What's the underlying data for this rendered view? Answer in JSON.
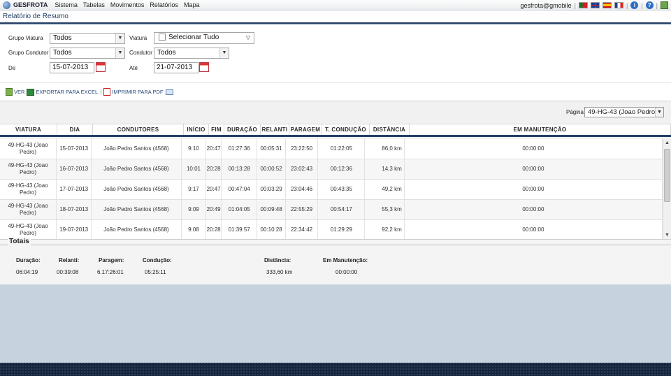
{
  "app": {
    "brand": "GESFROTA",
    "menu": [
      "Sistema",
      "Tabelas",
      "Movimentos",
      "Relatórios",
      "Mapa"
    ],
    "user": "gesfrota@gmobile",
    "separator": "|"
  },
  "page_title": "Relatório de Resumo",
  "filters": {
    "grupo_viatura_label": "Grupo Viatura",
    "grupo_viatura_value": "Todos",
    "viatura_label": "Viatura",
    "viatura_value": "Selecionar Tudo",
    "grupo_condutor_label": "Grupo Condutor",
    "grupo_condutor_value": "Todos",
    "condutor_label": "Condutor",
    "condutor_value": "Todos",
    "de_label": "De",
    "de_value": "15-07-2013",
    "ate_label": "Até",
    "ate_value": "21-07-2013"
  },
  "actions": {
    "ver": "VER",
    "excel": "EXPORTAR PARA EXCEL",
    "pdf": "IMPRIMIR PARA PDF",
    "sep": "|"
  },
  "pager": {
    "label": "Página",
    "value": "49-HG-43 (Joao Pedro)"
  },
  "table": {
    "headers": [
      "VIATURA",
      "DIA",
      "CONDUTORES",
      "INÍCIO",
      "FIM",
      "DURAÇÃO",
      "RELANTI",
      "PARAGEM",
      "T. CONDUÇÃO",
      "DISTÂNCIA",
      "EM MANUTENÇÃO"
    ],
    "rows": [
      [
        "49-HG-43 (Joao Pedro)",
        "15-07-2013",
        "João Pedro Santos (4568)",
        "9:10",
        "20:47",
        "01:27:36",
        "00:05:31",
        "23:22:50",
        "01:22:05",
        "86,0 km",
        "00:00:00"
      ],
      [
        "49-HG-43 (Joao Pedro)",
        "16-07-2013",
        "João Pedro Santos (4568)",
        "10:01",
        "20:28",
        "00:13:28",
        "00:00:52",
        "23:02:43",
        "00:12:36",
        "14,3 km",
        "00:00:00"
      ],
      [
        "49-HG-43 (Joao Pedro)",
        "17-07-2013",
        "João Pedro Santos (4568)",
        "9:17",
        "20:47",
        "00:47:04",
        "00:03:29",
        "23:04:46",
        "00:43:35",
        "49,2 km",
        "00:00:00"
      ],
      [
        "49-HG-43 (Joao Pedro)",
        "18-07-2013",
        "João Pedro Santos (4568)",
        "9:09",
        "20:49",
        "01:04:05",
        "00:09:48",
        "22:55:29",
        "00:54:17",
        "55,3 km",
        "00:00:00"
      ],
      [
        "49-HG-43 (Joao Pedro)",
        "19-07-2013",
        "João Pedro Santos (4568)",
        "9:08",
        "20:28",
        "01:39:57",
        "00:10:28",
        "22:34:42",
        "01:29:29",
        "92,2 km",
        "00:00:00"
      ]
    ]
  },
  "totals": {
    "legend": "Totais",
    "duracao_label": "Duração:",
    "duracao_value": "06:04:19",
    "relanti_label": "Relanti:",
    "relanti_value": "00:39:08",
    "paragem_label": "Paragem:",
    "paragem_value": "6.17:26:01",
    "conducao_label": "Condução:",
    "conducao_value": "05:25:11",
    "distancia_label": "Distância:",
    "distancia_value": "333,60 km",
    "manutencao_label": "Em Manutenção:",
    "manutencao_value": "00:00:00"
  }
}
